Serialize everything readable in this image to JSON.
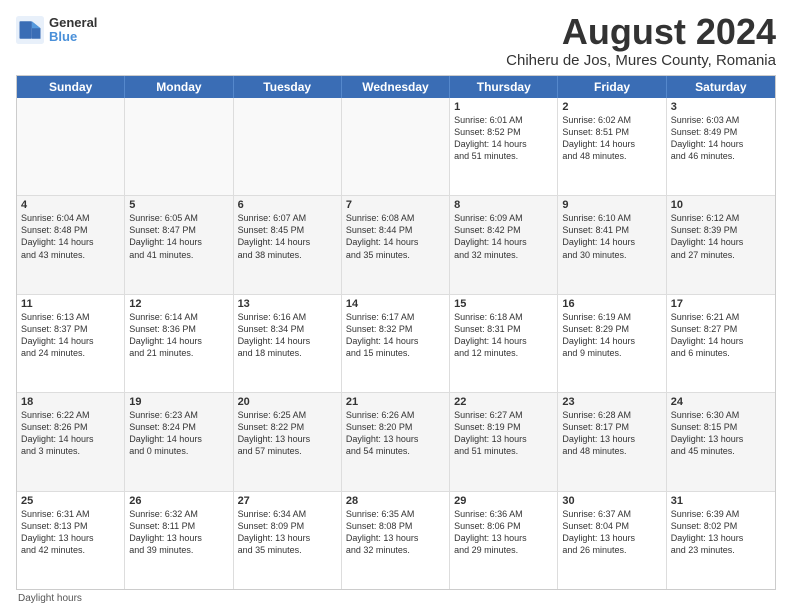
{
  "logo": {
    "line1": "General",
    "line2": "Blue"
  },
  "title": "August 2024",
  "subtitle": "Chiheru de Jos, Mures County, Romania",
  "headers": [
    "Sunday",
    "Monday",
    "Tuesday",
    "Wednesday",
    "Thursday",
    "Friday",
    "Saturday"
  ],
  "footer": "Daylight hours",
  "weeks": [
    [
      {
        "day": "",
        "info": ""
      },
      {
        "day": "",
        "info": ""
      },
      {
        "day": "",
        "info": ""
      },
      {
        "day": "",
        "info": ""
      },
      {
        "day": "1",
        "info": "Sunrise: 6:01 AM\nSunset: 8:52 PM\nDaylight: 14 hours\nand 51 minutes."
      },
      {
        "day": "2",
        "info": "Sunrise: 6:02 AM\nSunset: 8:51 PM\nDaylight: 14 hours\nand 48 minutes."
      },
      {
        "day": "3",
        "info": "Sunrise: 6:03 AM\nSunset: 8:49 PM\nDaylight: 14 hours\nand 46 minutes."
      }
    ],
    [
      {
        "day": "4",
        "info": "Sunrise: 6:04 AM\nSunset: 8:48 PM\nDaylight: 14 hours\nand 43 minutes."
      },
      {
        "day": "5",
        "info": "Sunrise: 6:05 AM\nSunset: 8:47 PM\nDaylight: 14 hours\nand 41 minutes."
      },
      {
        "day": "6",
        "info": "Sunrise: 6:07 AM\nSunset: 8:45 PM\nDaylight: 14 hours\nand 38 minutes."
      },
      {
        "day": "7",
        "info": "Sunrise: 6:08 AM\nSunset: 8:44 PM\nDaylight: 14 hours\nand 35 minutes."
      },
      {
        "day": "8",
        "info": "Sunrise: 6:09 AM\nSunset: 8:42 PM\nDaylight: 14 hours\nand 32 minutes."
      },
      {
        "day": "9",
        "info": "Sunrise: 6:10 AM\nSunset: 8:41 PM\nDaylight: 14 hours\nand 30 minutes."
      },
      {
        "day": "10",
        "info": "Sunrise: 6:12 AM\nSunset: 8:39 PM\nDaylight: 14 hours\nand 27 minutes."
      }
    ],
    [
      {
        "day": "11",
        "info": "Sunrise: 6:13 AM\nSunset: 8:37 PM\nDaylight: 14 hours\nand 24 minutes."
      },
      {
        "day": "12",
        "info": "Sunrise: 6:14 AM\nSunset: 8:36 PM\nDaylight: 14 hours\nand 21 minutes."
      },
      {
        "day": "13",
        "info": "Sunrise: 6:16 AM\nSunset: 8:34 PM\nDaylight: 14 hours\nand 18 minutes."
      },
      {
        "day": "14",
        "info": "Sunrise: 6:17 AM\nSunset: 8:32 PM\nDaylight: 14 hours\nand 15 minutes."
      },
      {
        "day": "15",
        "info": "Sunrise: 6:18 AM\nSunset: 8:31 PM\nDaylight: 14 hours\nand 12 minutes."
      },
      {
        "day": "16",
        "info": "Sunrise: 6:19 AM\nSunset: 8:29 PM\nDaylight: 14 hours\nand 9 minutes."
      },
      {
        "day": "17",
        "info": "Sunrise: 6:21 AM\nSunset: 8:27 PM\nDaylight: 14 hours\nand 6 minutes."
      }
    ],
    [
      {
        "day": "18",
        "info": "Sunrise: 6:22 AM\nSunset: 8:26 PM\nDaylight: 14 hours\nand 3 minutes."
      },
      {
        "day": "19",
        "info": "Sunrise: 6:23 AM\nSunset: 8:24 PM\nDaylight: 14 hours\nand 0 minutes."
      },
      {
        "day": "20",
        "info": "Sunrise: 6:25 AM\nSunset: 8:22 PM\nDaylight: 13 hours\nand 57 minutes."
      },
      {
        "day": "21",
        "info": "Sunrise: 6:26 AM\nSunset: 8:20 PM\nDaylight: 13 hours\nand 54 minutes."
      },
      {
        "day": "22",
        "info": "Sunrise: 6:27 AM\nSunset: 8:19 PM\nDaylight: 13 hours\nand 51 minutes."
      },
      {
        "day": "23",
        "info": "Sunrise: 6:28 AM\nSunset: 8:17 PM\nDaylight: 13 hours\nand 48 minutes."
      },
      {
        "day": "24",
        "info": "Sunrise: 6:30 AM\nSunset: 8:15 PM\nDaylight: 13 hours\nand 45 minutes."
      }
    ],
    [
      {
        "day": "25",
        "info": "Sunrise: 6:31 AM\nSunset: 8:13 PM\nDaylight: 13 hours\nand 42 minutes."
      },
      {
        "day": "26",
        "info": "Sunrise: 6:32 AM\nSunset: 8:11 PM\nDaylight: 13 hours\nand 39 minutes."
      },
      {
        "day": "27",
        "info": "Sunrise: 6:34 AM\nSunset: 8:09 PM\nDaylight: 13 hours\nand 35 minutes."
      },
      {
        "day": "28",
        "info": "Sunrise: 6:35 AM\nSunset: 8:08 PM\nDaylight: 13 hours\nand 32 minutes."
      },
      {
        "day": "29",
        "info": "Sunrise: 6:36 AM\nSunset: 8:06 PM\nDaylight: 13 hours\nand 29 minutes."
      },
      {
        "day": "30",
        "info": "Sunrise: 6:37 AM\nSunset: 8:04 PM\nDaylight: 13 hours\nand 26 minutes."
      },
      {
        "day": "31",
        "info": "Sunrise: 6:39 AM\nSunset: 8:02 PM\nDaylight: 13 hours\nand 23 minutes."
      }
    ]
  ]
}
